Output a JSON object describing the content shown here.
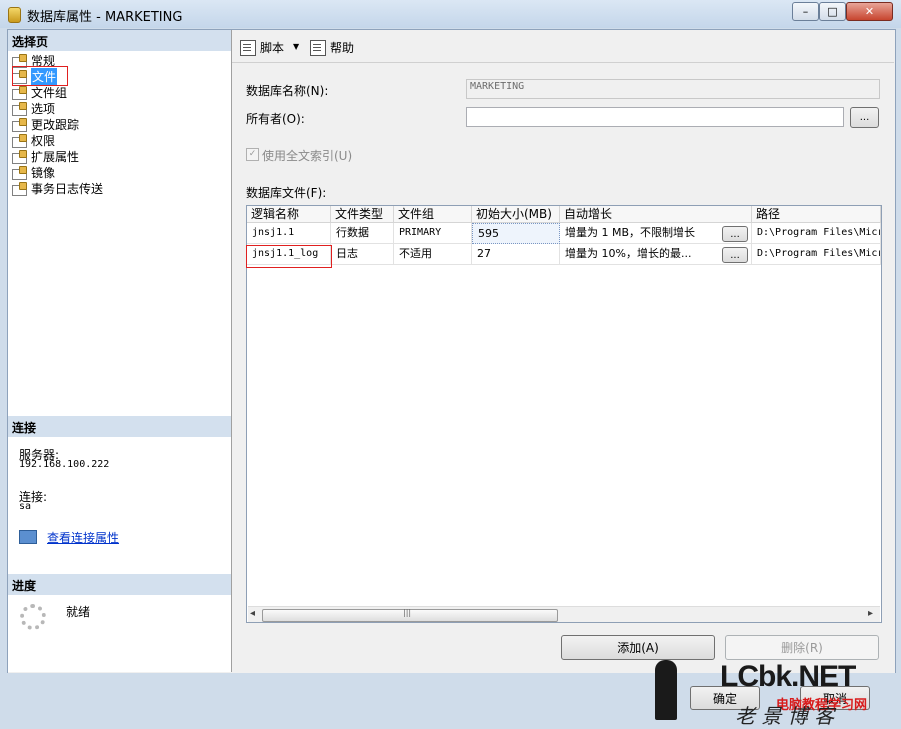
{
  "window": {
    "title": "数据库属性 - MARKETING",
    "minimize": "–",
    "maximize": "□",
    "close": "✕"
  },
  "left": {
    "select_page_header": "选择页",
    "pages": [
      {
        "label": "常规"
      },
      {
        "label": "文件"
      },
      {
        "label": "文件组"
      },
      {
        "label": "选项"
      },
      {
        "label": "更改跟踪"
      },
      {
        "label": "权限"
      },
      {
        "label": "扩展属性"
      },
      {
        "label": "镜像"
      },
      {
        "label": "事务日志传送"
      }
    ],
    "selected_index": 1,
    "connection_header": "连接",
    "server_label": "服务器:",
    "server_value": "192.168.100.222",
    "connection_label": "连接:",
    "connection_value": "sa",
    "view_connection_link": "查看连接属性",
    "progress_header": "进度",
    "progress_status": "就绪"
  },
  "toolbar": {
    "script_label": "脚本",
    "dropdown_arrow": "▼",
    "help_label": "帮助"
  },
  "form": {
    "db_name_label": "数据库名称(N):",
    "db_name_value": "MARKETING",
    "owner_label": "所有者(O):",
    "owner_value": "",
    "owner_browse": "...",
    "fulltext_label": "使用全文索引(U)",
    "fulltext_checked": true,
    "files_label": "数据库文件(F):"
  },
  "grid": {
    "columns": [
      "逻辑名称",
      "文件类型",
      "文件组",
      "初始大小(MB)",
      "自动增长",
      "路径"
    ],
    "rows": [
      {
        "logical": "jnsj1.1",
        "type": "行数据",
        "group": "PRIMARY",
        "size": "595",
        "growth": "增量为 1 MB，不限制增长",
        "path": "D:\\Program Files\\Micr"
      },
      {
        "logical": "jnsj1.1_log",
        "type": "日志",
        "group": "不适用",
        "size": "27",
        "growth": "增量为 10%，增长的最...",
        "path": "D:\\Program Files\\Micr"
      }
    ],
    "ellipsis": "...",
    "scroll_left": "◂",
    "scroll_right": "▸",
    "scroll_grip": "|||"
  },
  "buttons": {
    "add": "添加(A)",
    "remove": "删除(R)",
    "ok": "确定",
    "cancel": "取消"
  },
  "watermark": {
    "brand": "LCbk.NET",
    "site": "电脑教程学习网",
    "tagline": "老 景 博 客"
  }
}
